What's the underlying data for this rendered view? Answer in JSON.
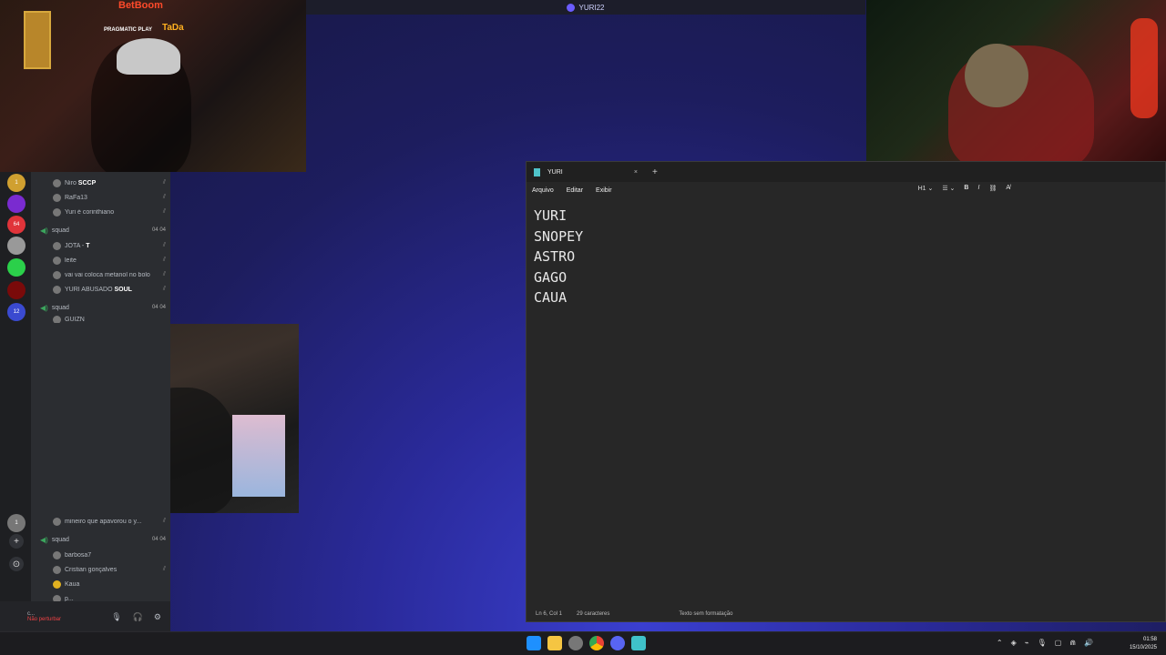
{
  "top_bar": {
    "title": "YURI22"
  },
  "stream_overlay": {
    "brand_main": "BetBoom",
    "brand_sub1": "PRAGMATIC PLAY",
    "brand_sub2": "TaDa"
  },
  "discord": {
    "voice_rows_top": [
      {
        "name": "Niro",
        "tag": "SCCP",
        "icon": "mute-icon"
      },
      {
        "name": "RaFa13",
        "tag": "",
        "icon": "mute-icon"
      },
      {
        "name": "Yuri é corinthiano",
        "tag": "",
        "icon": "mute-icon"
      }
    ],
    "channel_1": {
      "name": "squad",
      "badge_a": "04",
      "badge_b": "04"
    },
    "voice_rows_mid": [
      {
        "name": "JOTA -",
        "tag": "T",
        "icon": "mute-icon"
      },
      {
        "name": "leite",
        "tag": "",
        "icon": "mute-icon"
      },
      {
        "name": "vai vai coloca metanol no bolo",
        "tag": "",
        "icon": "mute-icon"
      },
      {
        "name": "YURI ABUSADO",
        "tag": "SOUL",
        "icon": "mute-icon"
      }
    ],
    "channel_2": {
      "name": "squad",
      "badge_a": "04",
      "badge_b": "04"
    },
    "voice_row_partial": {
      "name": "GUIZN"
    },
    "voice_rows_bottom": [
      {
        "name": "mineiro que apavorou o y...",
        "icon": "mute-icon"
      }
    ],
    "channel_3": {
      "name": "squad",
      "badge_a": "04",
      "badge_b": "04"
    },
    "voice_rows_last": [
      {
        "name": "barbosa7",
        "icon": ""
      },
      {
        "name": "Cristian gonçalves",
        "icon": "mute-icon"
      },
      {
        "name": "Kaua",
        "icon": ""
      },
      {
        "name": "p...",
        "icon": ""
      }
    ],
    "guild_badges": [
      "1",
      "64",
      "12",
      "1"
    ],
    "user_status": "Não perturbar",
    "user_name": "c..."
  },
  "notepad": {
    "tab_title": "YURI",
    "menu": [
      "Arquivo",
      "Editar",
      "Exibir"
    ],
    "heading_tool": "H1",
    "lines": [
      "YURI",
      "SNOPEY",
      "ASTRO",
      "GAGO",
      "CAUA"
    ],
    "status_position": "Ln 6, Col 1",
    "status_chars": "29 caracteres",
    "status_format": "Texto sem formatação"
  },
  "taskbar": {
    "time": "01:58",
    "date": "15/10/2025"
  },
  "colors": {
    "discord_bg": "#2b2d31",
    "accent_voice": "#3ba55d",
    "notepad_bg": "#272727",
    "desktop_blue": "#2a2a9a"
  }
}
